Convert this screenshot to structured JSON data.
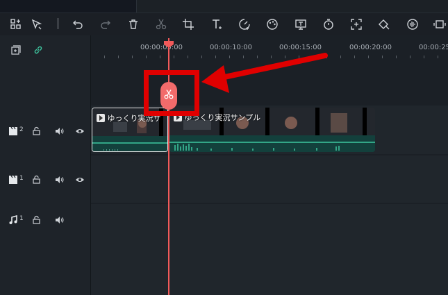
{
  "toolbar": {
    "icons": [
      "layout-icon",
      "select-tool-icon",
      "undo-icon",
      "redo-icon",
      "delete-icon",
      "cut-icon",
      "crop-icon",
      "text-icon",
      "speed-icon",
      "color-icon",
      "freeze-icon",
      "timer-icon",
      "fit-icon",
      "keyframe-icon",
      "audio-icon",
      "split-screen-icon"
    ]
  },
  "ruler": {
    "labels": [
      "00:00:05:00",
      "00:00:10:00",
      "00:00:15:00",
      "00:00:20:00",
      "00:00:25"
    ]
  },
  "tracks": [
    {
      "type": "video",
      "number": "2"
    },
    {
      "type": "video",
      "number": "1"
    },
    {
      "type": "audio",
      "number": "1"
    }
  ],
  "clips": [
    {
      "label": "ゆっくり実況サ"
    },
    {
      "label": "ゆっくり実況サンプル"
    }
  ],
  "colors": {
    "playhead": "#f25a5a",
    "annotation": "#e00000",
    "accent": "#3ec7a0"
  }
}
